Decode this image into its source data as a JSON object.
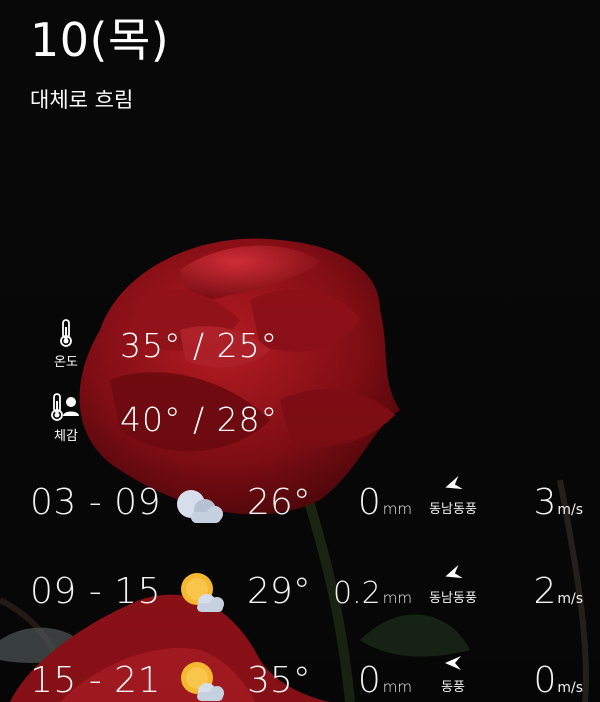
{
  "header": {
    "date": "10(목)",
    "condition": "대체로 흐림"
  },
  "stats": {
    "temperature": {
      "label": "온도",
      "value": "35° / 25°"
    },
    "feels_like": {
      "label": "체감",
      "value": "40° / 28°"
    }
  },
  "forecast": [
    {
      "time": "03 - 09",
      "icon": "cloudy-icon",
      "temp": "26°",
      "rain": "0",
      "rain_unit": "mm",
      "wind_dir": "동남동풍",
      "wind_speed": "3",
      "wind_unit": "m/s"
    },
    {
      "time": "09 - 15",
      "icon": "sun-behind-cloud-icon",
      "temp": "29°",
      "rain": "0.2",
      "rain_unit": "mm",
      "wind_dir": "동남동풍",
      "wind_speed": "2",
      "wind_unit": "m/s"
    },
    {
      "time": "15 - 21",
      "icon": "sun-behind-cloud-icon",
      "temp": "35°",
      "rain": "0",
      "rain_unit": "mm",
      "wind_dir": "동풍",
      "wind_speed": "0",
      "wind_unit": "m/s"
    }
  ],
  "colors": {
    "background": "#0a0a0a",
    "text": "#ffffff",
    "rose": "#b0141c",
    "sun": "#f6b731",
    "cloud": "#d5deea"
  }
}
